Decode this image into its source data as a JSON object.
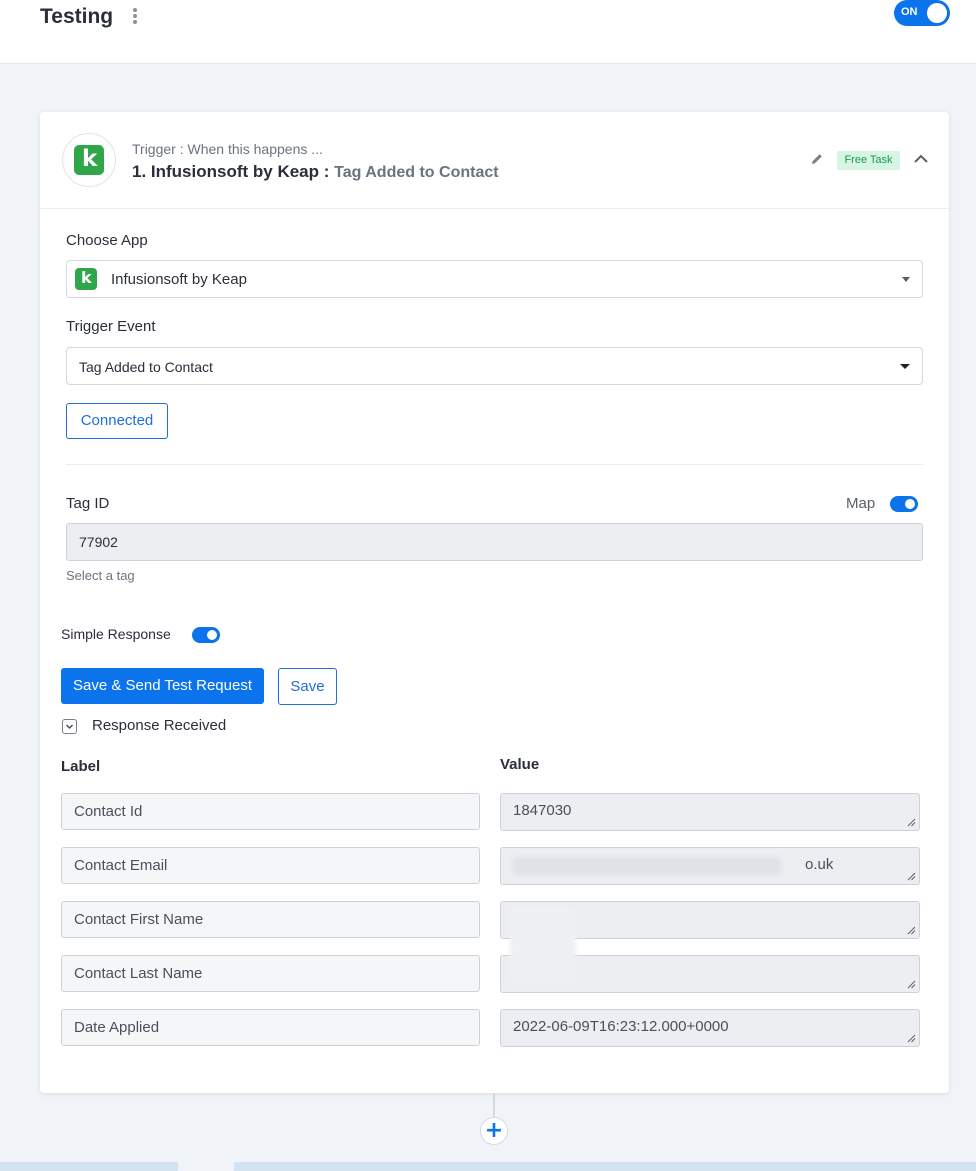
{
  "header": {
    "workflow_title": "Testing",
    "status_toggle": "ON"
  },
  "step": {
    "subtitle": "Trigger : When this happens ...",
    "title": "1. Infusionsoft by Keap :",
    "event": "Tag Added to Contact",
    "badge": "Free Task"
  },
  "form": {
    "choose_app_label": "Choose App",
    "app_value": "Infusionsoft by Keap",
    "trigger_event_label": "Trigger Event",
    "trigger_event_value": "Tag Added to Contact",
    "connected_label": "Connected",
    "tag_id_label": "Tag ID",
    "map_label": "Map",
    "tag_id_value": "77902",
    "tag_hint": "Select a tag",
    "simple_response_label": "Simple Response",
    "save_send_label": "Save & Send Test Request",
    "save_label": "Save",
    "response_received_label": "Response Received"
  },
  "response": {
    "label_header": "Label",
    "value_header": "Value",
    "rows": [
      {
        "label": "Contact Id",
        "value": "1847030"
      },
      {
        "label": "Contact Email",
        "value": "o.uk"
      },
      {
        "label": "Contact First Name",
        "value": ""
      },
      {
        "label": "Contact Last Name",
        "value": ""
      },
      {
        "label": "Date Applied",
        "value": "2022-06-09T16:23:12.000+0000"
      }
    ]
  },
  "colors": {
    "accent": "#0b73eb",
    "keap_green": "#2fa64a",
    "badge_bg": "#d6f5e3",
    "badge_text": "#1a9b55"
  },
  "icons": [
    "kebab-menu-icon",
    "keap-logo-icon",
    "pencil-icon",
    "chevron-up-icon",
    "dropdown-caret-icon",
    "chevron-down-icon",
    "resize-handle-icon",
    "plus-icon"
  ]
}
